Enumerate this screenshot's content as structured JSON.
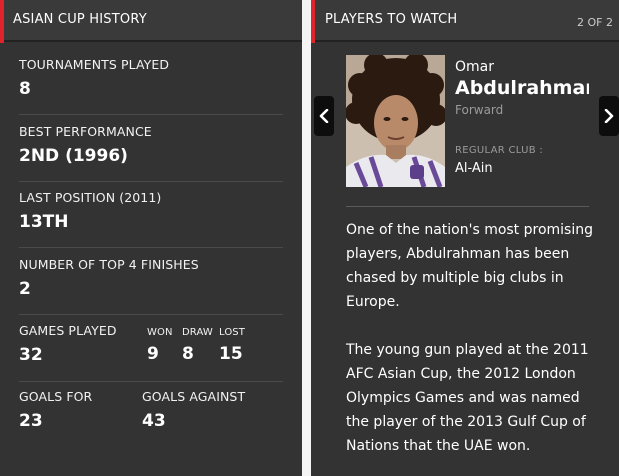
{
  "history": {
    "title": "ASIAN CUP HISTORY",
    "tournaments": {
      "label": "TOURNAMENTS PLAYED",
      "value": "8"
    },
    "best": {
      "label": "BEST PERFORMANCE",
      "value": "2ND (1996)"
    },
    "last": {
      "label": "LAST POSITION (2011)",
      "value": "13TH"
    },
    "top4": {
      "label": "NUMBER OF TOP 4 FINISHES",
      "value": "2"
    },
    "games": {
      "label": "GAMES PLAYED",
      "value": "32",
      "won_label": "WON",
      "won": "9",
      "draw_label": "DRAW",
      "draw": "8",
      "lost_label": "LOST",
      "lost": "15"
    },
    "goals_for": {
      "label": "GOALS FOR",
      "value": "23"
    },
    "goals_against": {
      "label": "GOALS AGAINST",
      "value": "43"
    }
  },
  "players": {
    "title": "PLAYERS TO WATCH",
    "pager": "2 OF 2",
    "prev_icon": "chevron-left-icon",
    "next_icon": "chevron-right-icon",
    "first_name": "Omar",
    "last_name": "Abdulrahman",
    "position": "Forward",
    "club_label": "REGULAR CLUB :",
    "club": "Al-Ain",
    "bio": [
      "One of the nation's most promising players, Abdulrahman has been chased by multiple big clubs in Europe.",
      "The young gun played at the 2011 AFC Asian Cup, the 2012 London Olympics Games and was named the player of the 2013 Gulf Cup of Nations that the UAE won."
    ]
  },
  "colors": {
    "accent": "#e0242b",
    "panel": "#333333",
    "header": "#3a3a3a",
    "muted": "#9a9a9a"
  }
}
